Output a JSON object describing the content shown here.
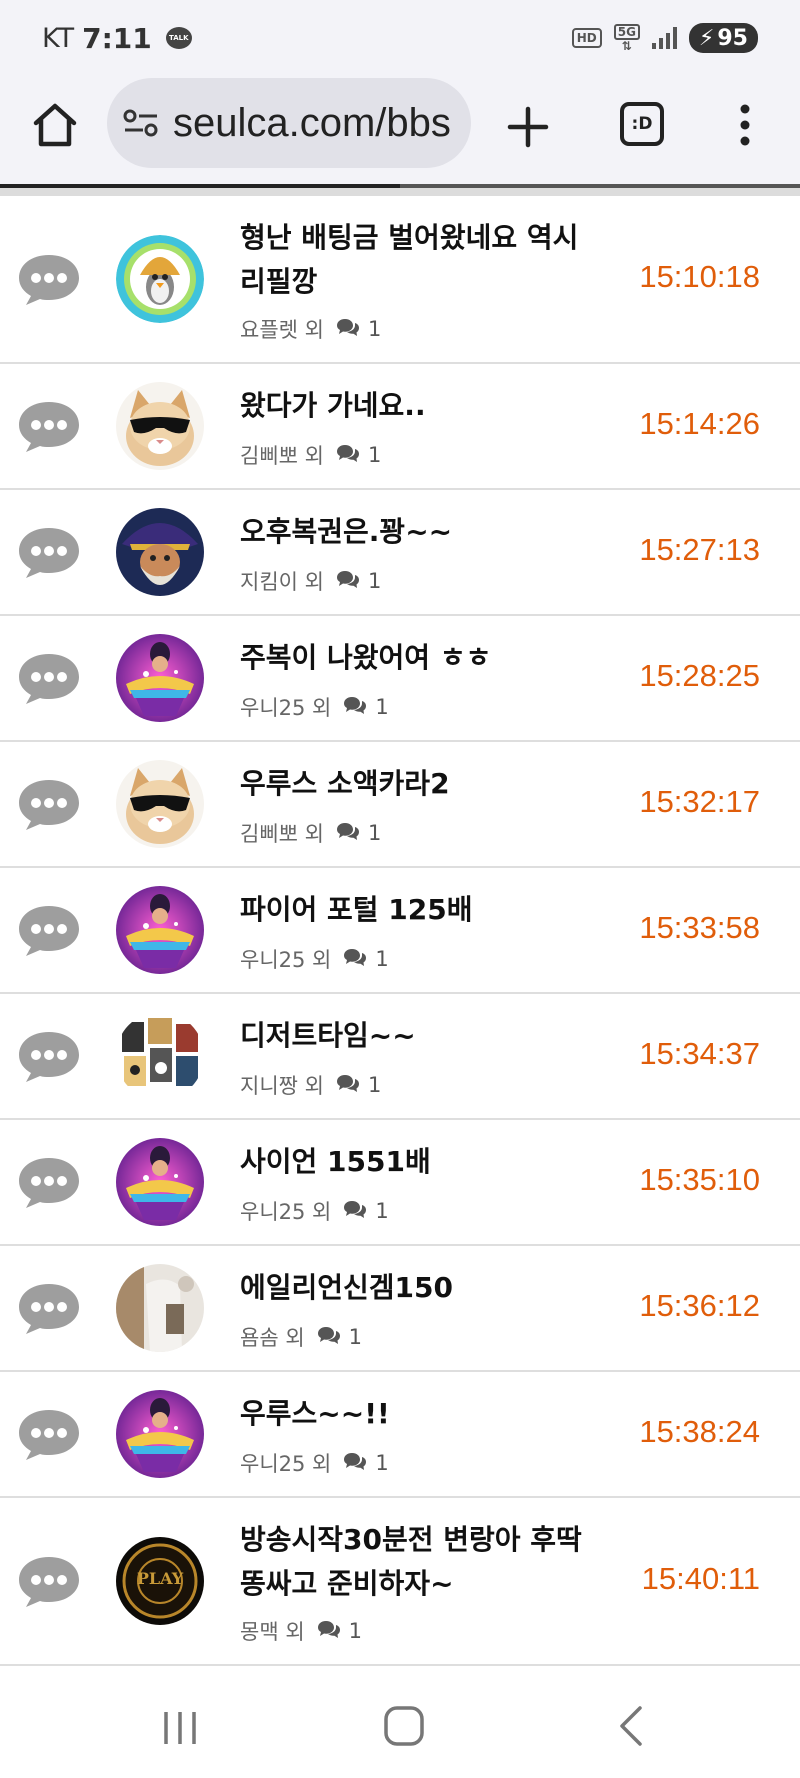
{
  "status_bar": {
    "carrier": "KT",
    "time": "7:11",
    "talk_badge": "TALK",
    "hd": "HD",
    "network": "5G",
    "battery": "95"
  },
  "browser": {
    "url": "seulca.com/bbs",
    "tabs_label": ":D"
  },
  "posts": [
    {
      "title": "형난 배팅금 벌어왔네요 역시 리필깡",
      "author": "요플렛 외",
      "comments": "1",
      "time": "15:10:18",
      "avatar": "penguin-avatar"
    },
    {
      "title": "왔다가 가네요..",
      "author": "김삐뽀 외",
      "comments": "1",
      "time": "15:14:26",
      "avatar": "cat-sunglasses-avatar"
    },
    {
      "title": "오후복권은.꽝~~",
      "author": "지킴이 외",
      "comments": "1",
      "time": "15:27:13",
      "avatar": "wizard-avatar"
    },
    {
      "title": "주복이 나왔어여 ㅎㅎ",
      "author": "우니25 외",
      "comments": "1",
      "time": "15:28:25",
      "avatar": "sultan-avatar"
    },
    {
      "title": "우루스 소액카라2",
      "author": "김삐뽀 외",
      "comments": "1",
      "time": "15:32:17",
      "avatar": "cat-sunglasses-avatar"
    },
    {
      "title": "파이어 포털 125배",
      "author": "우니25 외",
      "comments": "1",
      "time": "15:33:58",
      "avatar": "sultan-avatar"
    },
    {
      "title": "디저트타임~~",
      "author": "지니짱 외",
      "comments": "1",
      "time": "15:34:37",
      "avatar": "collage-avatar"
    },
    {
      "title": "사이언 1551배",
      "author": "우니25 외",
      "comments": "1",
      "time": "15:35:10",
      "avatar": "sultan-avatar"
    },
    {
      "title": "에일리언신겜150",
      "author": "욤솜 외",
      "comments": "1",
      "time": "15:36:12",
      "avatar": "photo-avatar"
    },
    {
      "title": "우루스~~!!",
      "author": "우니25 외",
      "comments": "1",
      "time": "15:38:24",
      "avatar": "sultan-avatar"
    },
    {
      "title": "방송시작30분전 변랑아 후딱 똥싸고 준비하자~",
      "author": "몽맥 외",
      "comments": "1",
      "time": "15:40:11",
      "avatar": "play-logo-avatar",
      "logo_text": "PLAY"
    }
  ],
  "colors": {
    "time": "#e05d0a",
    "chat_icon": "#9e9e9e"
  }
}
